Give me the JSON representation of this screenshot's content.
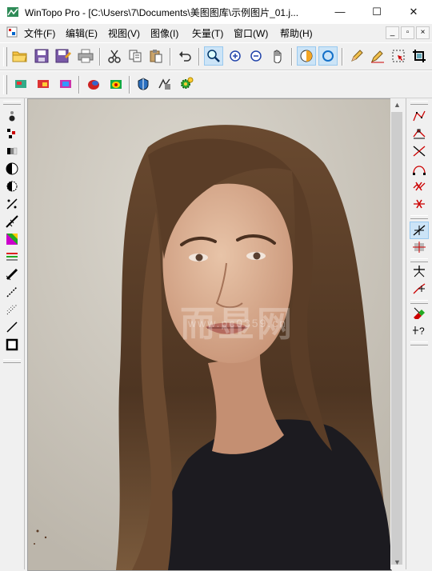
{
  "window": {
    "title": "WinTopo Pro - [C:\\Users\\7\\Documents\\美图图库\\示例图片_01.j...",
    "min_glyph": "—",
    "max_glyph": "☐",
    "close_glyph": "✕"
  },
  "menu": {
    "items": [
      "文件(F)",
      "编辑(E)",
      "视图(V)",
      "图像(I)",
      "矢量(T)",
      "窗口(W)",
      "帮助(H)"
    ],
    "mdi": [
      "_",
      "▫",
      "×"
    ]
  },
  "toolbar_main": {
    "icons": [
      "open-folder-icon",
      "save-icon",
      "save-as-icon",
      "print-icon",
      "cut-icon",
      "copy-icon",
      "paste-icon",
      "undo-icon",
      "zoom-icon",
      "zoom-in-icon",
      "zoom-out-icon",
      "pan-hand-icon",
      "view-raster-icon",
      "view-vector-icon",
      "pencil-icon",
      "eraser-pencil-icon",
      "select-area-icon",
      "crop-icon"
    ]
  },
  "toolbar_raster": {
    "icons": [
      "raster-tool-1-icon",
      "raster-tool-2-icon",
      "raster-tool-3-icon",
      "color-layers-icon",
      "color-fill-icon",
      "thin-icon",
      "vectorize-icon",
      "settings-gear-icon"
    ]
  },
  "canvas": {
    "watermark": "而显网",
    "watermark_sub": "www.pc0359.cn"
  },
  "colors": {
    "accent": "#0078d7",
    "active_bg": "#cce4f7"
  }
}
